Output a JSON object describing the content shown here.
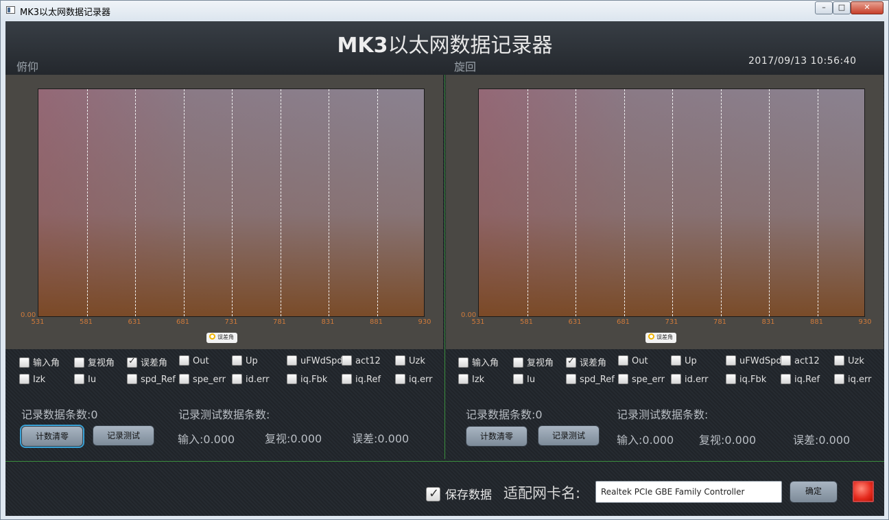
{
  "window": {
    "title": "MK3以太网数据记录器",
    "controls": [
      "0",
      "1",
      "r"
    ]
  },
  "header": {
    "title_bold": "MK3",
    "title_rest": "以太网数据记录器",
    "datetime": "2017/09/13  10:56:40"
  },
  "left": {
    "section_label": "俯仰",
    "chart": {
      "y_tick": "0.00",
      "x_ticks": [
        "531",
        "581",
        "631",
        "681",
        "731",
        "781",
        "831",
        "881",
        "930"
      ],
      "legend": "误差角"
    },
    "checkboxes": [
      {
        "label": "输入角",
        "checked": false
      },
      {
        "label": "复视角",
        "checked": false
      },
      {
        "label": "误差角",
        "checked": true
      },
      {
        "label": "Out",
        "checked": false
      },
      {
        "label": "Up",
        "checked": false
      },
      {
        "label": "uFWdSpd",
        "checked": false
      },
      {
        "label": "act12",
        "checked": false
      },
      {
        "label": "Uzk",
        "checked": false
      },
      {
        "label": "Izk",
        "checked": false
      },
      {
        "label": "Iu",
        "checked": false
      },
      {
        "label": "spd_Ref",
        "checked": false
      },
      {
        "label": "spe_err",
        "checked": false
      },
      {
        "label": "id.err",
        "checked": false
      },
      {
        "label": "iq.Fbk",
        "checked": false
      },
      {
        "label": "iq.Ref",
        "checked": false
      },
      {
        "label": "iq.err",
        "checked": false
      }
    ],
    "record_count": "记录数据条数:0",
    "test_count": "记录测试数据条数:",
    "reset_button": "计数清零",
    "test_button": "记录测试",
    "input": "输入:0.000",
    "review": "复视:0.000",
    "error": "误差:0.000"
  },
  "right": {
    "section_label": "旋回",
    "chart": {
      "y_tick": "0.00",
      "x_ticks": [
        "531",
        "581",
        "631",
        "681",
        "731",
        "781",
        "831",
        "881",
        "930"
      ],
      "legend": "误差角"
    },
    "checkboxes": [
      {
        "label": "输入角",
        "checked": false
      },
      {
        "label": "复视角",
        "checked": false
      },
      {
        "label": "误差角",
        "checked": true
      },
      {
        "label": "Out",
        "checked": false
      },
      {
        "label": "Up",
        "checked": false
      },
      {
        "label": "uFWdSpd",
        "checked": false
      },
      {
        "label": "act12",
        "checked": false
      },
      {
        "label": "Uzk",
        "checked": false
      },
      {
        "label": "Izk",
        "checked": false
      },
      {
        "label": "Iu",
        "checked": false
      },
      {
        "label": "spd_Ref",
        "checked": false
      },
      {
        "label": "spe_err",
        "checked": false
      },
      {
        "label": "id.err",
        "checked": false
      },
      {
        "label": "iq.Fbk",
        "checked": false
      },
      {
        "label": "iq.Ref",
        "checked": false
      },
      {
        "label": "iq.err",
        "checked": false
      }
    ],
    "record_count": "记录数据条数:0",
    "test_count": "记录测试数据条数:",
    "reset_button": "计数清零",
    "test_button": "记录测试",
    "input": "输入:0.000",
    "review": "复视:0.000",
    "error": "误差:0.000"
  },
  "footer": {
    "save_label": "保存数据",
    "save_checked": true,
    "nic_label": "适配网卡名:",
    "nic_value": "Realtek PCIe GBE Family Controller",
    "confirm_button": "确定",
    "status_led_color": "#e52b1e"
  }
}
